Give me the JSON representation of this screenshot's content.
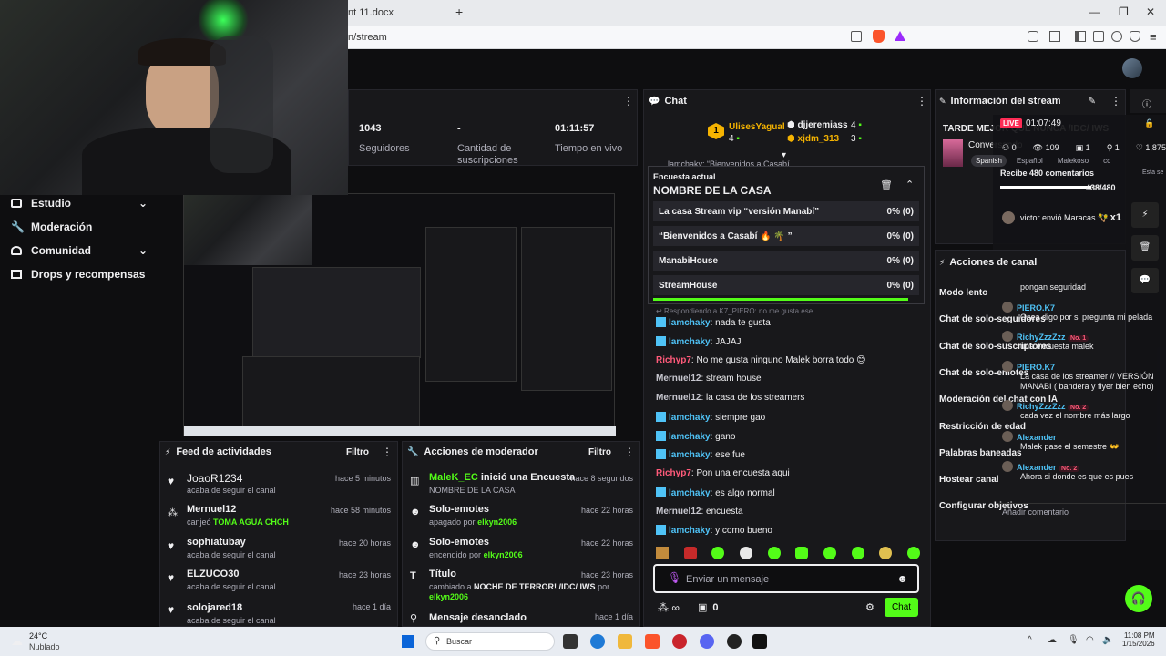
{
  "browser": {
    "tab_title": "nt 11.docx",
    "new_tab": "+",
    "address": "n/stream",
    "win_min": "—",
    "win_max": "❐",
    "win_close": "✕"
  },
  "stats": {
    "followers_value": "1043",
    "followers_label": "Seguidores",
    "subs_value": "-",
    "subs_label": "Cantidad de suscripciones",
    "live_time_value": "01:11:57",
    "live_time_label": "Tiempo en vivo"
  },
  "sidebar": {
    "items": [
      {
        "label": "Estudio",
        "icon": "studio-icon"
      },
      {
        "label": "Moderación",
        "icon": "wrench-icon"
      },
      {
        "label": "Comunidad",
        "icon": "community-icon"
      },
      {
        "label": "Drops y recompensas",
        "icon": "drops-icon"
      }
    ]
  },
  "activity_feed": {
    "title": "Feed de actividades",
    "filter": "Filtro",
    "items": [
      {
        "name": "JoaoR1234",
        "time": "hace 5 minutos",
        "sub": "acaba de seguir el canal",
        "extra": ""
      },
      {
        "name": "Mernuel12",
        "time": "hace 58 minutos",
        "sub": "canjeó",
        "extra": "TOMA AGUA CHCH"
      },
      {
        "name": "sophiatubay",
        "time": "hace 20 horas",
        "sub": "acaba de seguir el canal",
        "extra": ""
      },
      {
        "name": "ELZUCO30",
        "time": "hace 23 horas",
        "sub": "acaba de seguir el canal",
        "extra": ""
      },
      {
        "name": "solojared18",
        "time": "hace 1 día",
        "sub": "acaba de seguir el canal",
        "extra": ""
      }
    ]
  },
  "mod_actions": {
    "title": "Acciones de moderador",
    "filter": "Filtro",
    "items": [
      {
        "name": "MaleK_EC",
        "name2": "inició una Encuesta",
        "time": "hace 8 segundos",
        "sub": "NOMBRE DE LA CASA",
        "by": ""
      },
      {
        "name": "Solo-emotes",
        "name2": "",
        "time": "hace 22 horas",
        "sub": "apagado por",
        "by": "elkyn2006"
      },
      {
        "name": "Solo-emotes",
        "name2": "",
        "time": "hace 22 horas",
        "sub": "encendido por",
        "by": "elkyn2006"
      },
      {
        "name": "Título",
        "name2": "",
        "time": "hace 23 horas",
        "sub": "cambiado a",
        "subBold": "NOCHE DE TERROR! /IDC/ IWS",
        "sub2": "por",
        "by": "elkyn2006"
      },
      {
        "name": "Mensaje desanclado",
        "name2": "",
        "time": "hace 1 día",
        "sub": "",
        "by": ""
      }
    ]
  },
  "chat": {
    "title": "Chat",
    "top_gifters": [
      {
        "rank": "1",
        "name": "UlisesYagual",
        "count": "4"
      },
      {
        "rank": "",
        "name": "djjeremiass",
        "count": "4"
      },
      {
        "rank": "",
        "name": "xjdm_313",
        "count": "3"
      }
    ],
    "pinned_partial": "lamchaky: “Bienvenidos a Casabí",
    "poll": {
      "header": "Encuesta actual",
      "title": "NOMBRE DE LA CASA",
      "options": [
        {
          "label": "La casa Stream vip “versión Manabí”",
          "value": "0% (0)"
        },
        {
          "label": "“Bienvenidos a Casabí 🔥 🌴 ”",
          "value": "0% (0)"
        },
        {
          "label": "ManabiHouse",
          "value": "0% (0)"
        },
        {
          "label": "StreamHouse",
          "value": "0% (0)"
        }
      ]
    },
    "reply_hint": "Respondiendo a K7_PIERO: no me gusta ese",
    "messages": [
      {
        "user": "lamchaky",
        "text": "nada te gusta",
        "color": "cyan"
      },
      {
        "user": "lamchaky",
        "text": "JAJAJ",
        "color": "cyan"
      },
      {
        "user": "Richyp7",
        "text": "No me gusta ninguno Malek borra todo 😊",
        "color": "pink"
      },
      {
        "user": "Mernuel12",
        "text": "stream house",
        "color": "gray"
      },
      {
        "user": "Mernuel12",
        "text": "la casa de los streamers",
        "color": "gray"
      },
      {
        "user": "lamchaky",
        "text": "siempre gao",
        "color": "cyan"
      },
      {
        "user": "lamchaky",
        "text": "gano",
        "color": "cyan"
      },
      {
        "user": "lamchaky",
        "text": "ese fue",
        "color": "cyan"
      },
      {
        "user": "Richyp7",
        "text": "Pon una encuesta aqui",
        "color": "pink"
      },
      {
        "user": "lamchaky",
        "text": "es algo normal",
        "color": "cyan"
      },
      {
        "user": "Mernuel12",
        "text": "encuesta",
        "color": "gray"
      },
      {
        "user": "lamchaky",
        "text": "y como bueno",
        "color": "cyan"
      }
    ],
    "input_placeholder": "Enviar un mensaje",
    "points": "0",
    "send": "Chat"
  },
  "stream_info": {
    "title": "Información del stream",
    "stream_title": "TARDE MEJOR QUE NUNCA /IDC/ IWS",
    "category": "Conversando",
    "tags": [
      "Spanish",
      "Español",
      "Malekoso",
      "cc"
    ]
  },
  "overlay_stats": {
    "live_badge": "LIVE",
    "live_time": "01:07:49",
    "hearts_left": "0",
    "viewers": "109",
    "gifts": "1",
    "shares": "1",
    "likes": "1,875",
    "goal_text": "Recibe 480 comentarios",
    "goal_value": "438/480",
    "goal_progress": 0.9125,
    "gift_user": "victor",
    "gift_text": "envió Maracas 🪇",
    "gift_mult": "x1",
    "side_hint": "Esta se"
  },
  "channel_actions": {
    "title": "Acciones de canal",
    "items": [
      "Modo lento",
      "Chat de solo-seguidores",
      "Chat de solo-suscriptores",
      "Chat de solo-emotes",
      "Moderación del chat con IA",
      "Restricción de edad",
      "Palabras baneadas",
      "Hostear canal",
      "Configurar objetivos"
    ]
  },
  "comments": {
    "items": [
      {
        "user": "",
        "text": "pongan seguridad",
        "rank": ""
      },
      {
        "user": "PIERO.K7",
        "text": "Osea digo por si pregunta mi pelada",
        "rank": ""
      },
      {
        "user": "RichyZzzZzz",
        "text": "una encuesta malek",
        "rank": "No. 1"
      },
      {
        "user": "PIERO.K7",
        "text": "La casa de los streamer // VERSIÓN MANABI ( bandera y flyer bien echo)",
        "rank": ""
      },
      {
        "user": "RichyZzzZzz",
        "text": "cada vez el nombre más largo",
        "rank": "No. 2"
      },
      {
        "user": "Alexander",
        "text": "Malek pase el semestre 👐",
        "rank": ""
      },
      {
        "user": "Alexander",
        "text": "Ahora si donde es que es pues",
        "rank": "No. 2"
      }
    ],
    "input_placeholder": "Añadir comentario"
  },
  "taskbar": {
    "weather_temp": "24°C",
    "weather_desc": "Nublado",
    "search": "Buscar",
    "time": "11:08 PM",
    "date": "1/15/2026"
  },
  "colors": {
    "accent": "#53fc18",
    "bg": "#0e0e10",
    "panel": "#18181b"
  }
}
